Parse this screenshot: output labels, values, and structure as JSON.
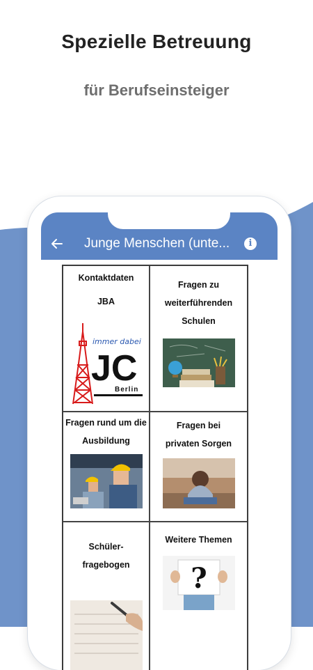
{
  "header": {
    "headline": "Spezielle Betreuung",
    "subline": "für Berufseinsteiger"
  },
  "app": {
    "title": "Junge Menschen (unte...",
    "back_icon": "arrow-left-icon",
    "info_icon": "info-icon"
  },
  "tiles": [
    {
      "lines": [
        "Kontaktdaten",
        "JBA"
      ],
      "logo_text": "immer dabei",
      "logo_main": "JC",
      "logo_city": "Berlin",
      "image": "jobcenter-berlin-logo"
    },
    {
      "lines": [
        "Fragen zu",
        "weiterführenden",
        "Schulen"
      ],
      "image": "books-globe-chalkboard-photo"
    },
    {
      "lines": [
        "Fragen rund um die",
        "Ausbildung"
      ],
      "image": "apprentice-workers-photo"
    },
    {
      "lines": [
        "Fragen bei",
        "privaten Sorgen"
      ],
      "image": "sad-person-photo"
    },
    {
      "lines": [
        "Schüler-",
        "fragebogen"
      ],
      "image": "questionnaire-writing-photo"
    },
    {
      "lines": [
        "Weitere Themen"
      ],
      "image": "question-mark-sign-photo"
    }
  ],
  "colors": {
    "accent": "#5b84c4",
    "wave": "#6f93c9"
  }
}
